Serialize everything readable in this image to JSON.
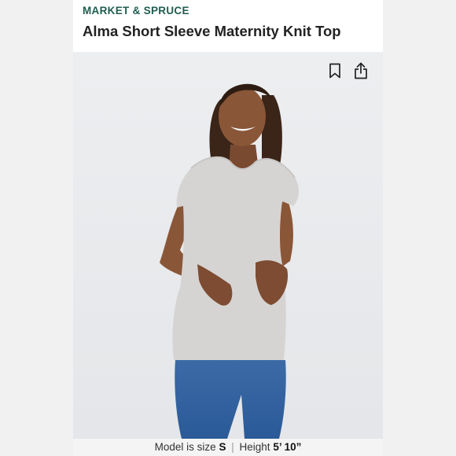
{
  "brand": {
    "name": "MARKET & SPRUCE",
    "color": "#1f5e50"
  },
  "product": {
    "title": "Alma Short Sleeve Maternity Knit Top"
  },
  "toolbar": {
    "bookmark_icon": "bookmark-icon",
    "share_icon": "share-icon"
  },
  "caption": {
    "model_label": "Model is size",
    "size": "S",
    "separator": "|",
    "height_label": "Height",
    "height": "5’ 10”"
  }
}
